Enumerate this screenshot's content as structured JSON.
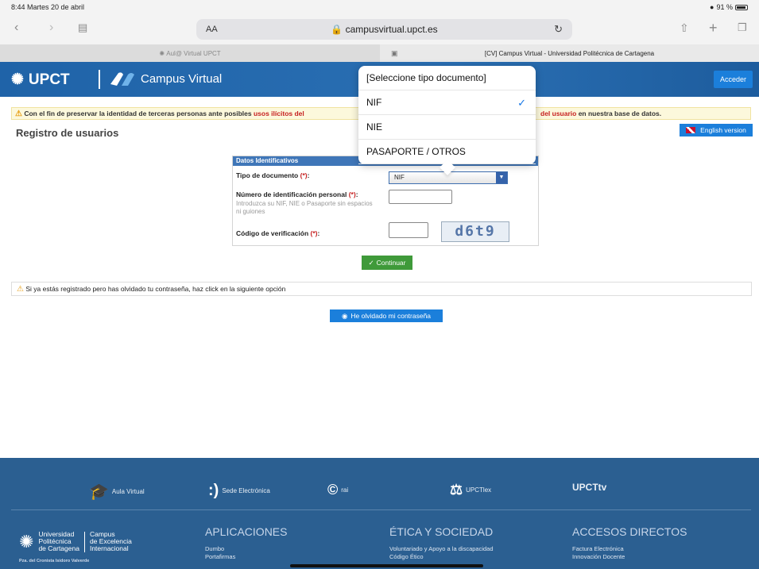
{
  "status_bar": {
    "time": "8:44  Martes 20 de abril",
    "battery": "91 %"
  },
  "browser": {
    "text_size": "AA",
    "url": "campusvirtual.upct.es",
    "tabs": [
      {
        "title": "Aul@ Virtual UPCT"
      },
      {
        "title": "[CV] Campus Virtual - Universidad Politécnica de Cartagena"
      }
    ]
  },
  "header": {
    "logo": "UPCT",
    "campus": "Campus Virtual",
    "login_button": "Acceder"
  },
  "warning": {
    "part1": "Con el fin de preservar la identidad de terceras personas ante posibles ",
    "red1": "usos ilícitos del",
    "red2": "del usuario",
    "part2": " en nuestra base de datos."
  },
  "page_title": "Registro de usuarios",
  "english_button": "English version",
  "form": {
    "section_title": "Datos Identificativos",
    "doc_type_label": "Tipo de documento",
    "required_mark": "(*)",
    "doc_type_value": "NIF",
    "id_number_label": "Número de identificación personal",
    "id_number_hint": "Introduzca su NIF, NIE o Pasaporte sin espacios ni guiones",
    "captcha_label": "Código de verificación",
    "captcha_text": "d6t9",
    "colon": ":"
  },
  "continue_button": "Continuar",
  "forgot_info": "Si ya estás registrado pero has olvidado tu contraseña, haz click en la siguiente opción",
  "forgot_button": "He olvidado mi contraseña",
  "dropdown": {
    "options": [
      "[Seleccione tipo documento]",
      "NIF",
      "NIE",
      "PASAPORTE / OTROS"
    ],
    "selected": "NIF",
    "check": "✓"
  },
  "footer": {
    "links": [
      "Aula Virtual",
      "Sede Electrónica",
      "rai",
      "UPCTlex",
      "UPCTtv"
    ],
    "university": [
      "Universidad",
      "Politécnica",
      "de Cartagena"
    ],
    "campus_excellence": [
      "Campus",
      "de Excelencia",
      "Internacional"
    ],
    "address": "Pza. del Cronista Isidoro Valverde",
    "columns": [
      {
        "title": "APLICACIONES",
        "items": [
          "Dumbo",
          "Portafirmas"
        ]
      },
      {
        "title": "ÉTICA Y SOCIEDAD",
        "items": [
          "Voluntariado y Apoyo a la discapacidad",
          "Código Ético"
        ]
      },
      {
        "title": "ACCESOS DIRECTOS",
        "items": [
          "Factura Electrónica",
          "Innovación Docente"
        ]
      }
    ]
  }
}
